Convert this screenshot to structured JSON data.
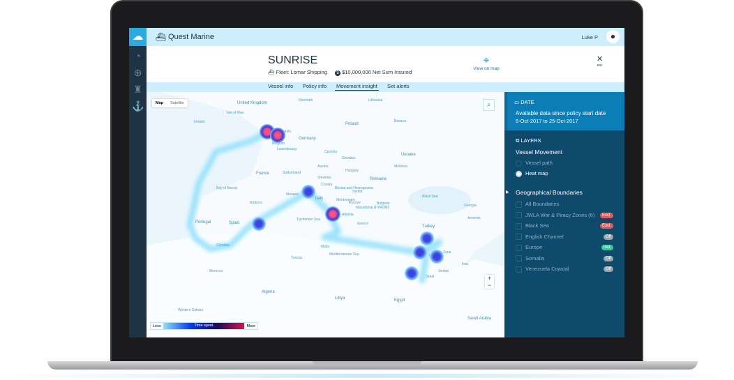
{
  "app": {
    "title": "Quest Marine",
    "user": "Luke P"
  },
  "vessel": {
    "name": "SUNRISE",
    "fleet": "Fleet: Lomar Shipping",
    "sum_insured": "$10,000,000 Net Sum Insured",
    "view_on_map": "View on map",
    "close_hint": "esc"
  },
  "tabs": [
    {
      "label": "Vessel info"
    },
    {
      "label": "Policy info"
    },
    {
      "label": "Movement insight",
      "active": true
    },
    {
      "label": "Set alerts"
    }
  ],
  "map": {
    "type_buttons": [
      "Map",
      "Satellite"
    ],
    "zoom_in": "+",
    "zoom_out": "−",
    "labels": [
      "United Kingdom",
      "Ireland",
      "Isle of Man",
      "Denmark",
      "Lithuania",
      "Belarus",
      "Poland",
      "Germany",
      "Netherlands",
      "Belgium",
      "Luxembourg",
      "Czechia",
      "Slovakia",
      "Ukraine",
      "Austria",
      "Hungary",
      "Moldova",
      "France",
      "Switzerland",
      "Slovenia",
      "Croatia",
      "Romania",
      "Bosnia and Herzegovina",
      "Serbia",
      "Bay of Biscay",
      "Monaco",
      "Italy",
      "Andorra",
      "Montenegro",
      "Kosovo",
      "Bulgaria",
      "Black Sea",
      "Macedonia (FYROM)",
      "Georgia",
      "Albania",
      "Portugal",
      "Spain",
      "Tyrrhenian Sea",
      "Greece",
      "Armenia",
      "Turkey",
      "Gibraltar",
      "Malta",
      "Syria",
      "Tunisia",
      "Mediterranean Sea",
      "Lebanon",
      "Iraq",
      "Morocco",
      "Jordan",
      "Israel",
      "Algeria",
      "Libya",
      "Egypt",
      "Western Sahara",
      "Saudi Arabia"
    ],
    "legend": {
      "less": "Less",
      "title": "Time spent",
      "more": "More"
    }
  },
  "panel": {
    "date": {
      "heading": "DATE",
      "line1": "Available data since policy start date",
      "line2": "6-Oct-2017 to 25-Oct-2017"
    },
    "layers": {
      "heading": "LAYERS",
      "group": "Vessel Movement",
      "options": [
        {
          "label": "Vessel path",
          "selected": false
        },
        {
          "label": "Heat map",
          "selected": true
        }
      ]
    },
    "boundaries": {
      "heading": "Geographical Boundaries",
      "items": [
        {
          "label": "All Boundaries",
          "badge": null
        },
        {
          "label": "JWLA War & Piracy Zones (6)",
          "badge": "Excl."
        },
        {
          "label": "Black Sea",
          "badge": "Excl."
        },
        {
          "label": "English Channel",
          "badge": "Off"
        },
        {
          "label": "Europe",
          "badge": "Incl."
        },
        {
          "label": "Somalia",
          "badge": "Off"
        },
        {
          "label": "Venezuela Coastal",
          "badge": "Off"
        }
      ]
    }
  },
  "colors": {
    "accent": "#29abe2",
    "topbar": "#cdeefc",
    "sidebar": "#1d3446",
    "panel": "#0d4a6c",
    "date_box": "#0b7db7",
    "excl": "#e05a5a",
    "incl": "#3cc79a",
    "off": "#9aa3a8"
  },
  "icons": {
    "logo": "cloud-logo-icon",
    "sidebar": [
      "gauge-icon",
      "globe-icon",
      "lighthouse-icon",
      "ship-icon"
    ]
  }
}
